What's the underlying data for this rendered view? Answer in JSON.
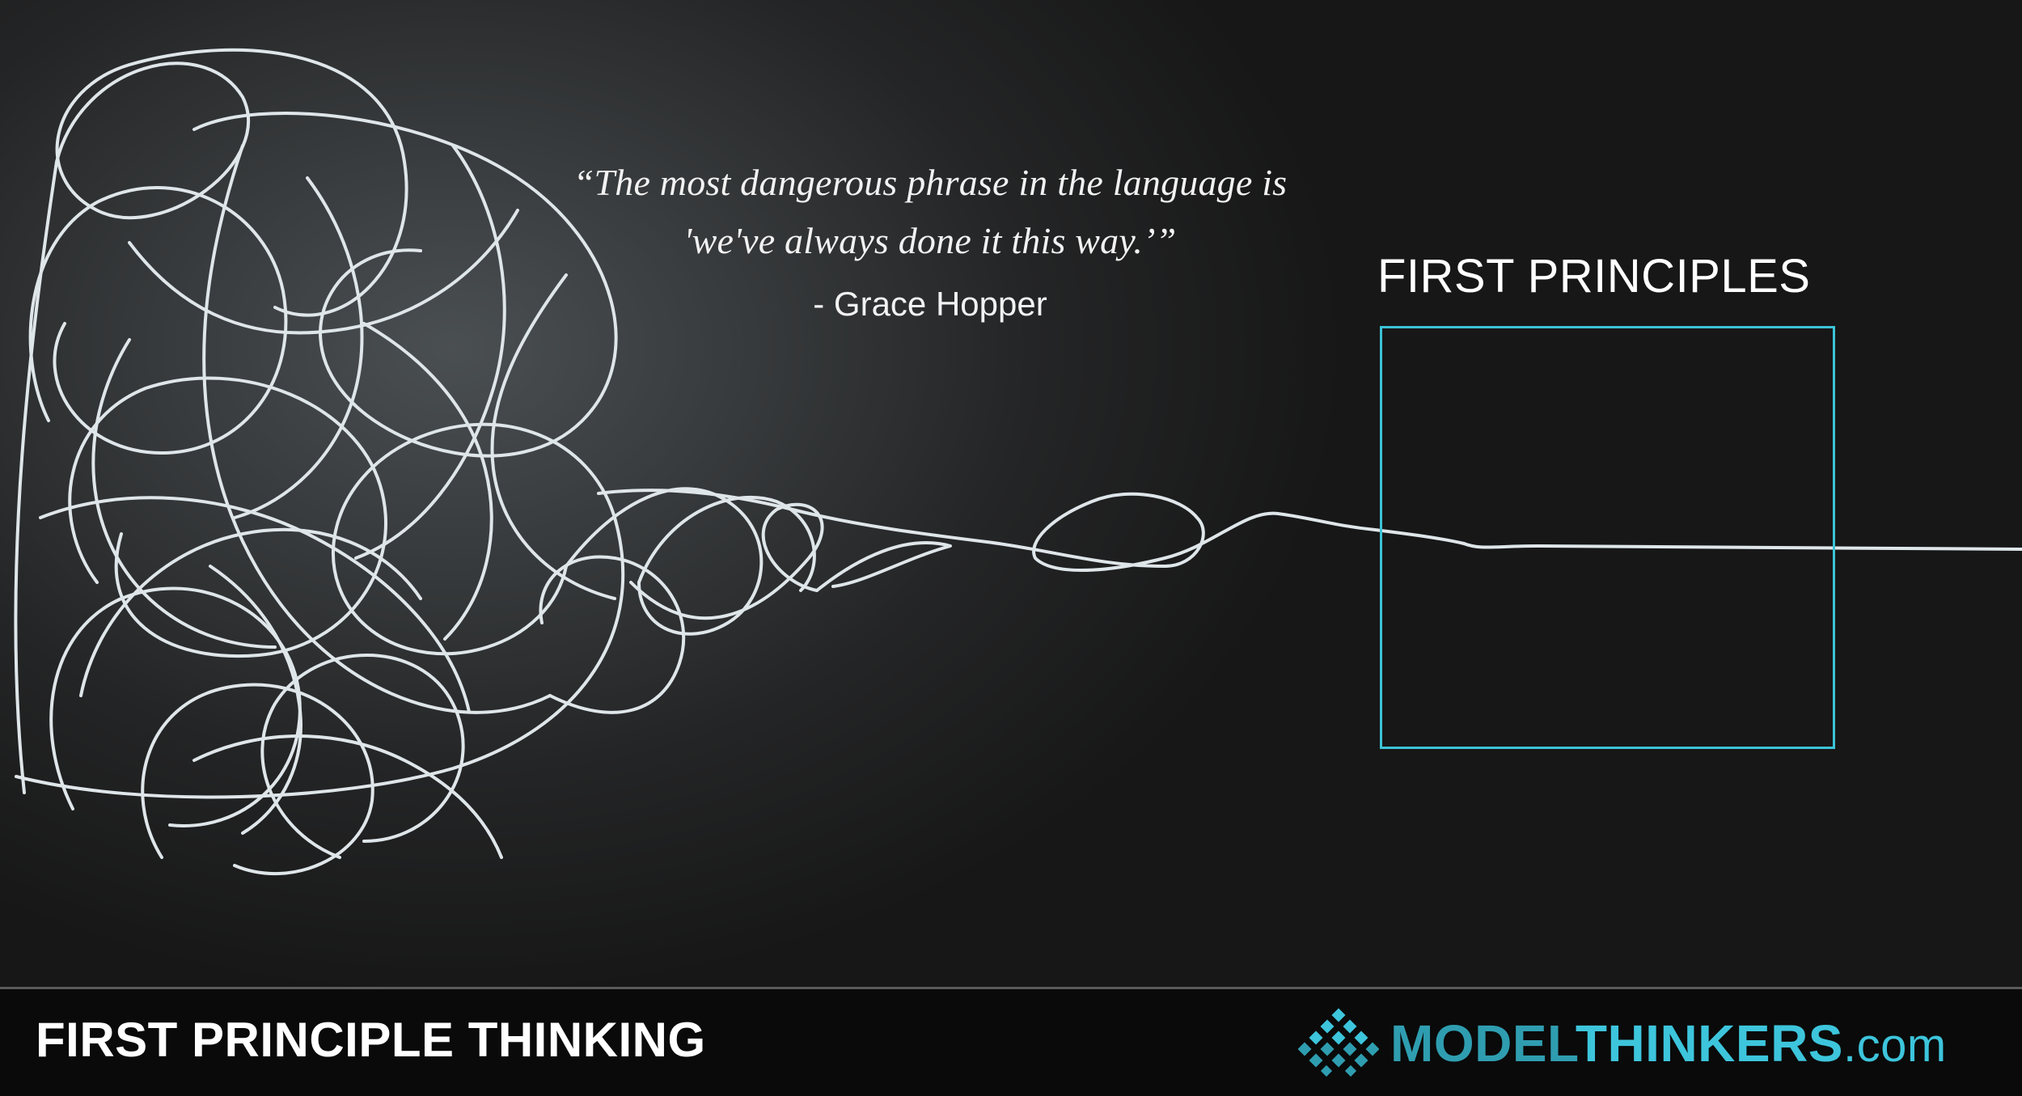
{
  "quote": {
    "line1": "“The most dangerous phrase in the language is",
    "line2": "'we've always done it this way.’”",
    "author": "- Grace Hopper"
  },
  "box_label": "FIRST PRINCIPLES",
  "footer": {
    "title": "FIRST PRINCIPLE THINKING",
    "brand": {
      "part1": "MODEL",
      "part2": "THINKERS",
      "part3": ".com"
    }
  },
  "colors": {
    "accent": "#3cc3d6",
    "line": "#dfe6ea",
    "background": "#2a2c2d",
    "footer_bg": "#0a0a0a"
  },
  "icons": [
    "tangled-line-icon",
    "diamond-grid-logo-icon"
  ]
}
